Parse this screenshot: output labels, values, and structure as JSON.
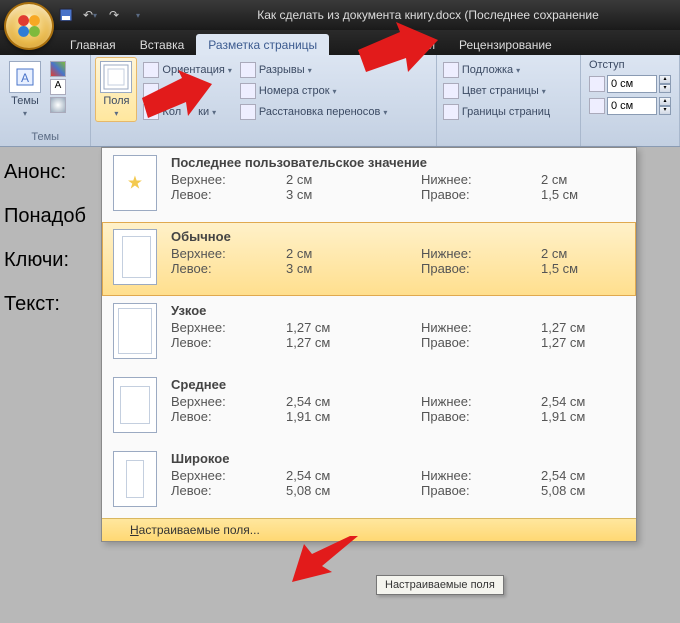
{
  "title": "Как сделать из документа книгу.docx (Последнее сохранение",
  "tabs": {
    "home": "Главная",
    "insert": "Вставка",
    "layout": "Разметка страницы",
    "mail": "Рассылки",
    "review": "Рецензирование"
  },
  "ribbon": {
    "themes_label": "Темы",
    "themes_btn": "Темы",
    "margins_btn": "Поля",
    "orientation": "Ориентация",
    "breaks": "Разрывы",
    "size_suffix": "ер",
    "linenumbers": "Номера строк",
    "columns_prefix": "Кол",
    "columns_suffix": "ки",
    "hyphen": "Расстановка переносов",
    "watermark": "Подложка",
    "pagecolor": "Цвет страницы",
    "borders": "Границы страниц",
    "indent_label": "Отступ",
    "indent_val1": "0 см",
    "indent_val2": "0 см"
  },
  "doc": {
    "l1": "Анонс:",
    "l2": "Понадоб",
    "l3": "Ключи:",
    "l4": "Текст:"
  },
  "gallery": {
    "last": {
      "title": "Последнее пользовательское значение",
      "top_k": "Верхнее:",
      "top_v": "2 см",
      "bot_k": "Нижнее:",
      "bot_v": "2 см",
      "left_k": "Левое:",
      "left_v": "3 см",
      "right_k": "Правое:",
      "right_v": "1,5 см"
    },
    "normal": {
      "title": "Обычное",
      "top_k": "Верхнее:",
      "top_v": "2 см",
      "bot_k": "Нижнее:",
      "bot_v": "2 см",
      "left_k": "Левое:",
      "left_v": "3 см",
      "right_k": "Правое:",
      "right_v": "1,5 см"
    },
    "narrow": {
      "title": "Узкое",
      "top_k": "Верхнее:",
      "top_v": "1,27 см",
      "bot_k": "Нижнее:",
      "bot_v": "1,27 см",
      "left_k": "Левое:",
      "left_v": "1,27 см",
      "right_k": "Правое:",
      "right_v": "1,27 см"
    },
    "medium": {
      "title": "Среднее",
      "top_k": "Верхнее:",
      "top_v": "2,54 см",
      "bot_k": "Нижнее:",
      "bot_v": "2,54 см",
      "left_k": "Левое:",
      "left_v": "1,91 см",
      "right_k": "Правое:",
      "right_v": "1,91 см"
    },
    "wide": {
      "title": "Широкое",
      "top_k": "Верхнее:",
      "top_v": "2,54 см",
      "bot_k": "Нижнее:",
      "bot_v": "2,54 см",
      "left_k": "Левое:",
      "left_v": "5,08 см",
      "right_k": "Правое:",
      "right_v": "5,08 см"
    },
    "custom_prefix": "Н",
    "custom_rest": "астраиваемые поля..."
  },
  "tooltip": "Настраиваемые поля"
}
